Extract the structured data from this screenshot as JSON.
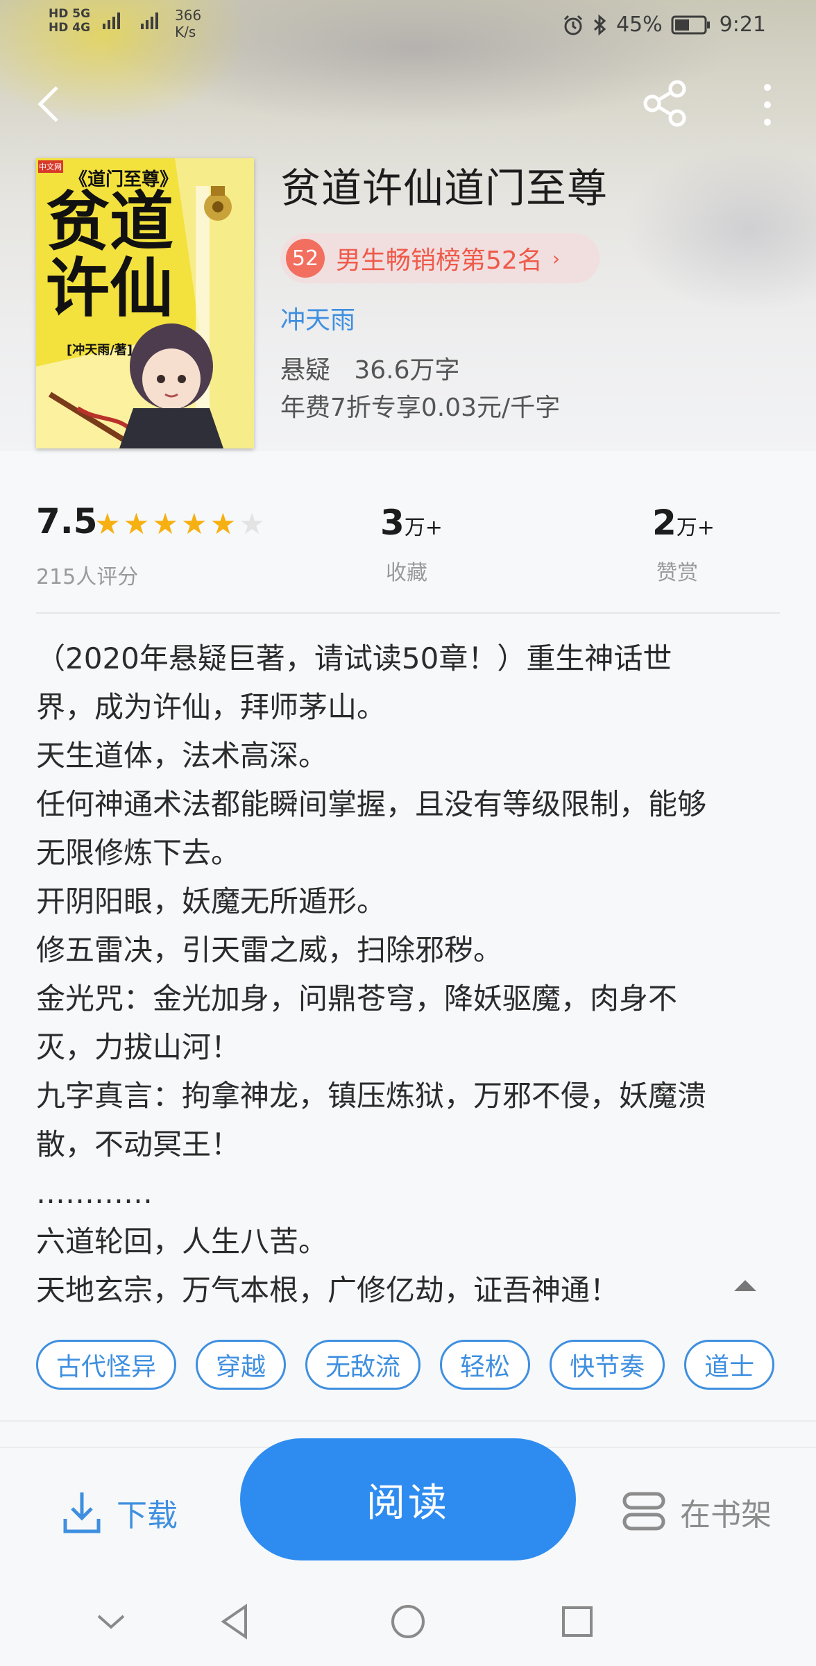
{
  "status_bar": {
    "sim1": "HD",
    "sim2": "HD",
    "net1": "5G",
    "net2": "4G",
    "net_speed_value": "366",
    "net_speed_unit": "K/s",
    "battery": "45%",
    "time": "9:21"
  },
  "nav": {
    "back_icon": "chevron-left-icon",
    "share_icon": "share-icon",
    "more_icon": "more-vertical-icon"
  },
  "cover": {
    "subtitle": "《道门至尊》",
    "title_line1": "贫道",
    "title_line2": "许仙",
    "author_tag": "[冲天雨/著]",
    "publisher": "中文网"
  },
  "book": {
    "title": "贫道许仙道门至尊",
    "rank_num": "52",
    "rank_text": "男生畅销榜第52名",
    "rank_chevron": "›",
    "author": "冲天雨",
    "meta_line1": "悬疑   36.6万字",
    "meta_line2": "年费7折专享0.03元/千字"
  },
  "stats": {
    "score": "7.5",
    "stars_filled": 5,
    "stars_total": 6,
    "rating_count": "215人评分",
    "favorites_value": "3",
    "favorites_unit": "万+",
    "favorites_label": "收藏",
    "rewards_value": "2",
    "rewards_unit": "万+",
    "rewards_label": "赞赏"
  },
  "description": {
    "lines": [
      "（2020年悬疑巨著，请试读50章！）重生神话世",
      "界，成为许仙，拜师茅山。",
      "天生道体，法术高深。",
      "任何神通术法都能瞬间掌握，且没有等级限制，能够",
      "无限修炼下去。",
      "开阴阳眼，妖魔无所遁形。",
      "修五雷决，引天雷之威，扫除邪秽。",
      "金光咒：金光加身，问鼎苍穹，降妖驱魔，肉身不",
      "灭，力拔山河！",
      "九字真言：拘拿神龙，镇压炼狱，万邪不侵，妖魔溃",
      "散，不动冥王！",
      "…………",
      "六道轮回，人生八苦。",
      "天地玄宗，万气本根，广修亿劫，证吾神通！"
    ],
    "collapse_icon": "chevron-up-icon"
  },
  "tags": [
    "古代怪异",
    "穿越",
    "无敌流",
    "轻松",
    "快节奏",
    "道士"
  ],
  "actions": {
    "download_label": "下载",
    "read_label": "阅读",
    "shelf_label": "在书架"
  },
  "colors": {
    "accent": "#3f8fe0",
    "read_button": "#2e8cf0",
    "rank_text": "#ef5a4a",
    "star": "#f6b012"
  }
}
